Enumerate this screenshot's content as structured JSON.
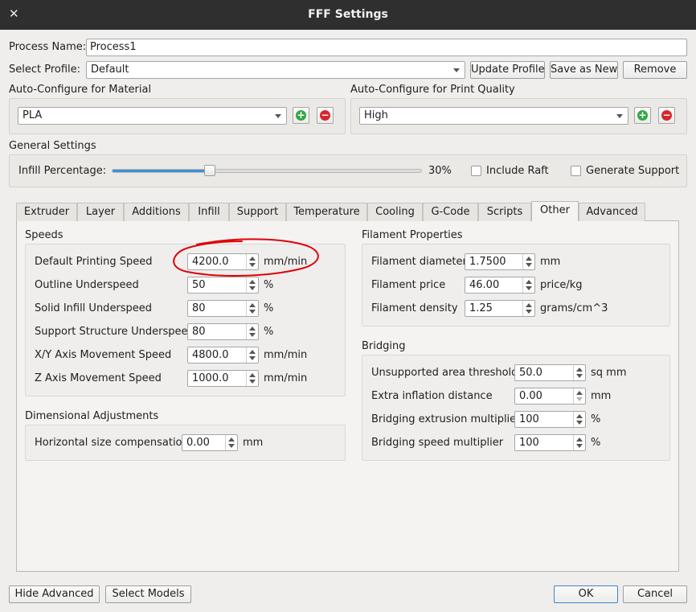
{
  "window": {
    "title": "FFF Settings"
  },
  "process_name": {
    "label": "Process Name:",
    "value": "Process1"
  },
  "profile": {
    "label": "Select Profile:",
    "value": "Default",
    "update_label": "Update Profile",
    "save_as_new_label": "Save as New",
    "remove_label": "Remove"
  },
  "material": {
    "label": "Auto-Configure for Material",
    "value": "PLA"
  },
  "quality": {
    "label": "Auto-Configure for Print Quality",
    "value": "High"
  },
  "general": {
    "label": "General Settings",
    "infill_label": "Infill Percentage:",
    "infill_value": "30%",
    "infill_fraction": 0.3,
    "include_raft_label": "Include Raft",
    "include_raft_checked": false,
    "generate_support_label": "Generate Support",
    "generate_support_checked": false
  },
  "tabs": [
    {
      "label": "Extruder"
    },
    {
      "label": "Layer"
    },
    {
      "label": "Additions"
    },
    {
      "label": "Infill"
    },
    {
      "label": "Support"
    },
    {
      "label": "Temperature"
    },
    {
      "label": "Cooling"
    },
    {
      "label": "G-Code"
    },
    {
      "label": "Scripts"
    },
    {
      "label": "Other"
    },
    {
      "label": "Advanced"
    }
  ],
  "active_tab": "Other",
  "speeds": {
    "title": "Speeds",
    "rows": [
      {
        "label": "Default Printing Speed",
        "value": "4200.0",
        "unit": "mm/min"
      },
      {
        "label": "Outline Underspeed",
        "value": "50",
        "unit": "%"
      },
      {
        "label": "Solid Infill Underspeed",
        "value": "80",
        "unit": "%"
      },
      {
        "label": "Support Structure Underspeed",
        "value": "80",
        "unit": "%"
      },
      {
        "label": "X/Y Axis Movement Speed",
        "value": "4800.0",
        "unit": "mm/min"
      },
      {
        "label": "Z Axis Movement Speed",
        "value": "1000.0",
        "unit": "mm/min"
      }
    ]
  },
  "dimensional": {
    "title": "Dimensional Adjustments",
    "rows": [
      {
        "label": "Horizontal size compensation",
        "value": "0.00",
        "unit": "mm"
      }
    ]
  },
  "filament": {
    "title": "Filament Properties",
    "rows": [
      {
        "label": "Filament diameter",
        "value": "1.7500",
        "unit": "mm"
      },
      {
        "label": "Filament price",
        "value": "46.00",
        "unit": "price/kg"
      },
      {
        "label": "Filament density",
        "value": "1.25",
        "unit": "grams/cm^3"
      }
    ]
  },
  "bridging": {
    "title": "Bridging",
    "rows": [
      {
        "label": "Unsupported area threshold",
        "value": "50.0",
        "unit": "sq mm"
      },
      {
        "label": "Extra inflation distance",
        "value": "0.00",
        "unit": "mm"
      },
      {
        "label": "Bridging extrusion multiplier",
        "value": "100",
        "unit": "%"
      },
      {
        "label": "Bridging speed multiplier",
        "value": "100",
        "unit": "%"
      }
    ]
  },
  "footer": {
    "hide_advanced_label": "Hide Advanced",
    "select_models_label": "Select Models",
    "ok_label": "OK",
    "cancel_label": "Cancel"
  },
  "colors": {
    "annotation": "#e0000a",
    "slider_fill": "#3d8fd6",
    "add": "#33a745",
    "remove": "#d7262a"
  }
}
